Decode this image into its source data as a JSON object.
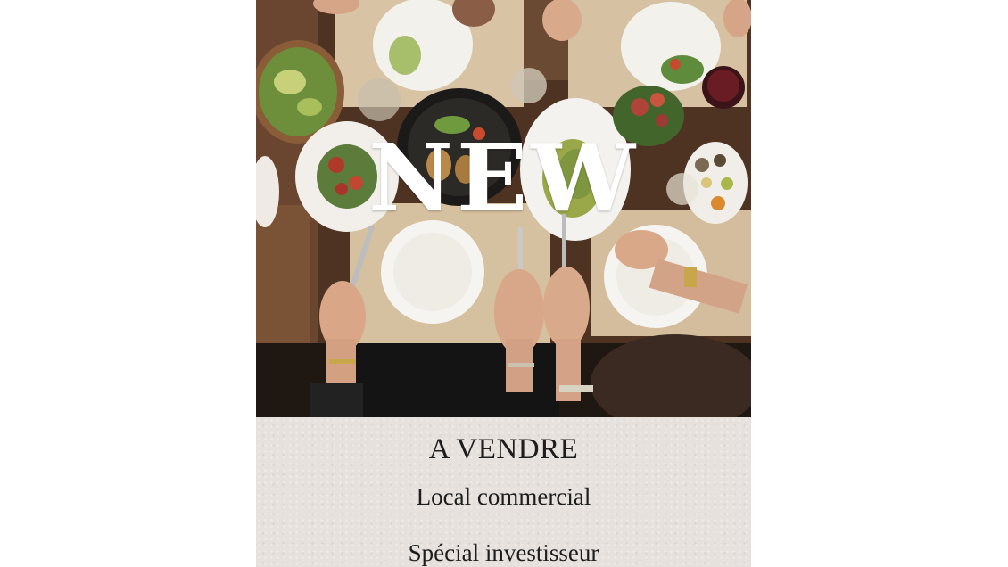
{
  "poster": {
    "headline": "NEW",
    "title": "A VENDRE",
    "subtitle": "Local commercial",
    "tagline": "Spécial investisseur"
  },
  "colors": {
    "table_wood": "#5a3a26",
    "placemat": "#d9c6a8",
    "plate": "#f4f2ee",
    "caption_background": "#e6e1dc",
    "caption_text": "#1d1d1d",
    "headline_text": "#ffffff"
  },
  "icons": [
    "dining-table-photo"
  ]
}
